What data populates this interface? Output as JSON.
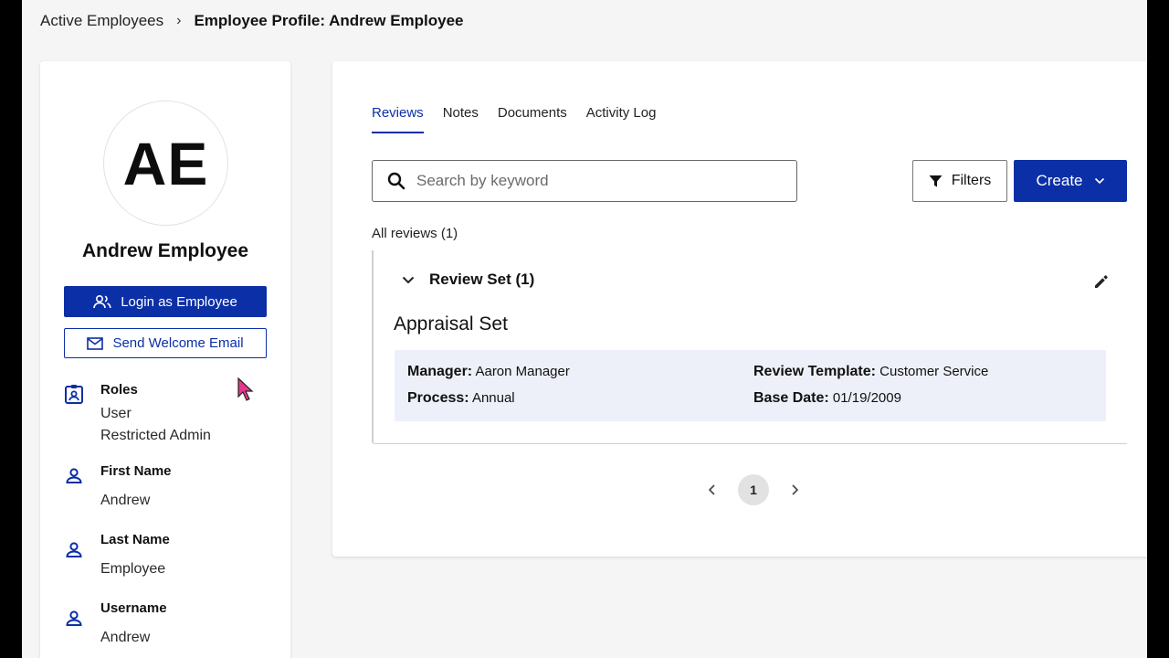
{
  "breadcrumb": {
    "parent": "Active Employees",
    "current": "Employee Profile: Andrew Employee"
  },
  "profile": {
    "initials": "AE",
    "name": "Andrew Employee",
    "login_label": "Login as Employee",
    "welcome_label": "Send Welcome Email",
    "roles_label": "Roles",
    "roles": [
      "User",
      "Restricted Admin"
    ],
    "first_name_label": "First Name",
    "first_name": "Andrew",
    "last_name_label": "Last Name",
    "last_name": "Employee",
    "username_label": "Username",
    "username": "Andrew"
  },
  "tabs": [
    {
      "label": "Reviews",
      "active": true
    },
    {
      "label": "Notes",
      "active": false
    },
    {
      "label": "Documents",
      "active": false
    },
    {
      "label": "Activity Log",
      "active": false
    }
  ],
  "search": {
    "placeholder": "Search by keyword"
  },
  "toolbar": {
    "filters_label": "Filters",
    "create_label": "Create"
  },
  "reviews": {
    "count_label": "All reviews (1)",
    "set_title": "Review Set (1)",
    "item_title": "Appraisal Set",
    "manager_key": "Manager:",
    "manager_val": "Aaron Manager",
    "process_key": "Process:",
    "process_val": "Annual",
    "template_key": "Review Template:",
    "template_val": "Customer Service",
    "base_date_key": "Base Date:",
    "base_date_val": "01/19/2009"
  },
  "pagination": {
    "current_page": "1"
  },
  "colors": {
    "primary": "#0b2fa6",
    "details_bg": "#eef0f9",
    "cursor": "#e8368f"
  }
}
